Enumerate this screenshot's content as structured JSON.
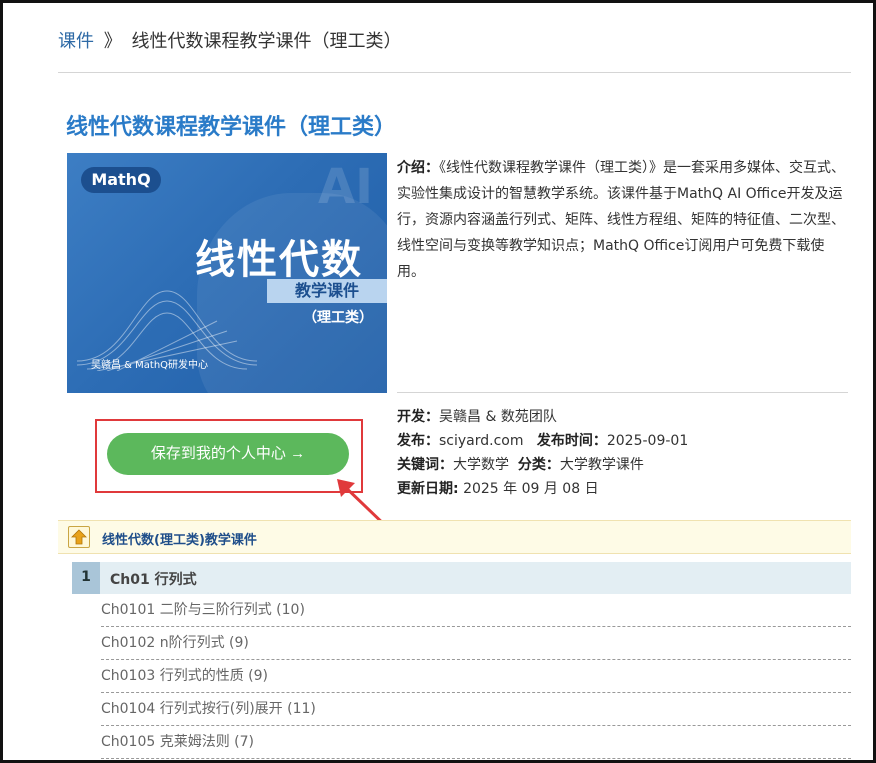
{
  "breadcrumb": {
    "link": "课件",
    "separator": "》",
    "current": "线性代数课程教学课件（理工类）"
  },
  "page_title": "线性代数课程教学课件（理工类）",
  "cover": {
    "logo": "MathQ",
    "ai_mark": "AI",
    "title": "线性代数",
    "subtitle": "教学课件",
    "tag": "（理工类）",
    "credit": "吴赣昌 & MathQ研发中心"
  },
  "intro": {
    "label": "介绍：",
    "text": "《线性代数课程教学课件（理工类）》是一套采用多媒体、交互式、实验性集成设计的智慧教学系统。该课件基于MathQ AI Office开发及运行，资源内容涵盖行列式、矩阵、线性方程组、矩阵的特征值、二次型、线性空间与变换等教学知识点；MathQ Office订阅用户可免费下载使用。"
  },
  "meta": {
    "developer_label": "开发：",
    "developer": "吴赣昌 & 数苑团队",
    "publisher_label": "发布：",
    "publisher": "sciyard.com",
    "pubtime_label": "发布时间：",
    "pubtime": "2025-09-01",
    "keywords_label": "关键词：",
    "keywords": "大学数学",
    "category_label": "分类：",
    "category": "大学教学课件",
    "updated_label": "更新日期:",
    "updated": "2025 年 09 月 08 日"
  },
  "save_button": "保存到我的个人中心 →",
  "section": {
    "title": "线性代数(理工类)教学课件"
  },
  "chapter": {
    "number": "1",
    "label": "Ch01 行列式"
  },
  "items": [
    "Ch0101 二阶与三阶行列式 (10)",
    "Ch0102 n阶行列式 (9)",
    "Ch0103 行列式的性质 (9)",
    "Ch0104 行列式按行(列)展开 (11)",
    "Ch0105 克莱姆法则 (7)"
  ],
  "colors": {
    "title_blue": "#2a7bc8",
    "button_green": "#5cb85c",
    "highlight_red": "#e0393b"
  }
}
